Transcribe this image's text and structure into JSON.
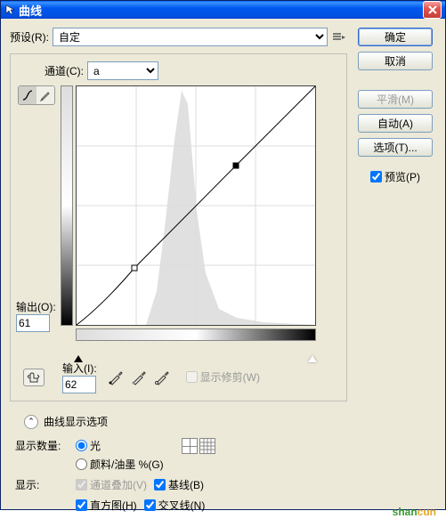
{
  "window": {
    "title": "曲线"
  },
  "preset": {
    "label": "预设(R):",
    "value": "自定"
  },
  "channel": {
    "label": "通道(C):",
    "value": "a"
  },
  "output": {
    "label": "输出(O):",
    "value": "61"
  },
  "input": {
    "label": "输入(I):",
    "value": "62"
  },
  "showclip": {
    "label": "显示修剪(W)"
  },
  "disclosure": {
    "label": "曲线显示选项"
  },
  "display_amount": {
    "label": "显示数量:",
    "opt_light": "光",
    "opt_pigment": "颜料/油墨 %(G)"
  },
  "show": {
    "label": "显示:",
    "overlay": "通道叠加(V)",
    "baseline": "基线(B)",
    "histogram": "直方图(H)",
    "intersection": "交叉线(N)"
  },
  "buttons": {
    "ok": "确定",
    "cancel": "取消",
    "smooth": "平滑(M)",
    "auto": "自动(A)",
    "options": "选项(T)..."
  },
  "preview": {
    "label": "预览(P)"
  },
  "watermark": {
    "text1": "shan",
    "text2": "cun"
  },
  "chart_data": {
    "type": "curve",
    "title": "",
    "xlabel": "输入",
    "ylabel": "输出",
    "xlim": [
      0,
      255
    ],
    "ylim": [
      0,
      255
    ],
    "points": [
      {
        "in": 0,
        "out": 0
      },
      {
        "in": 62,
        "out": 61
      },
      {
        "in": 170,
        "out": 170
      },
      {
        "in": 255,
        "out": 255
      }
    ],
    "grid_divisions": 4
  }
}
